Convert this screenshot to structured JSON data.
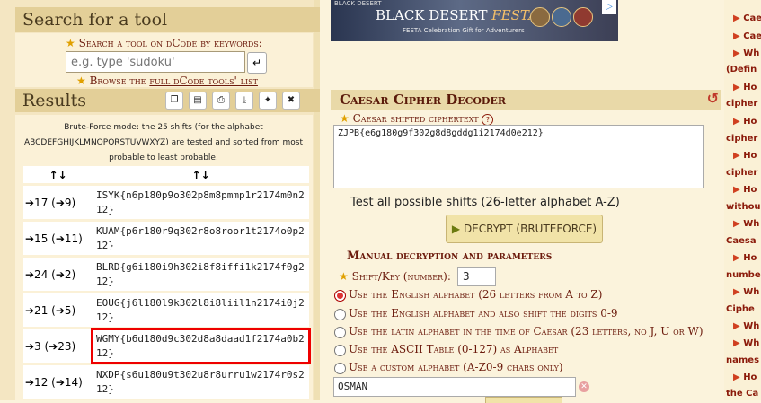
{
  "search": {
    "title": "Search for a tool",
    "label": "Search a tool on dCode by keywords:",
    "placeholder": "e.g. type 'sudoku'",
    "browse_label": "Browse the",
    "browse_link": "full dCode tools' list"
  },
  "results": {
    "title": "Results",
    "description": "Brute-Force mode: the 25 shifts (for the alphabet ABCDEFGHIJKLMNOPQRSTUVWXYZ) are tested and sorted from most probable to least probable.",
    "col1": "↑↓",
    "col2": "↑↓",
    "rows": [
      {
        "shift": "➔17 (➔9)",
        "text": "ISYK{n6p180p9o302p8m8pmmp1r2174m0n212}"
      },
      {
        "shift": "➔15 (➔11)",
        "text": "KUAM{p6r180r9q302r8o8roor1t2174o0p212}"
      },
      {
        "shift": "➔24 (➔2)",
        "text": "BLRD{g6i180i9h302i8f8iffi1k2174f0g212}"
      },
      {
        "shift": "➔21 (➔5)",
        "text": "EOUG{j6l180l9k302l8i8liil1n2174i0j212}"
      },
      {
        "shift": "➔3 (➔23)",
        "text": "WGMY{b6d180d9c302d8a8daad1f2174a0b212}"
      },
      {
        "shift": "➔12 (➔14)",
        "text": "NXDP{s6u180u9t302u8r8urru1w2174r0s212}"
      }
    ]
  },
  "ad": {
    "brand": "BLACK DESERT",
    "festa": "FESTA",
    "tagline": "FESTA Celebration Gift for Adventurers"
  },
  "decoder": {
    "title": "Caesar Cipher Decoder",
    "cipher_label": "Caesar shifted ciphertext",
    "cipher_value": "ZJPB{e6g180g9f302g8d8gddg1i2174d0e212}",
    "test_all": "Test all possible shifts (26-letter alphabet A-Z)",
    "bruteforce_button": "DECRYPT (BRUTEFORCE)",
    "manual_title": "Manual decryption and parameters",
    "shift_label": "Shift/Key (number):",
    "shift_value": "3",
    "options": [
      "Use the English alphabet (26 letters from A to Z)",
      "Use the English alphabet and also shift the digits 0-9",
      "Use the latin alphabet in the time of Caesar (23 letters, no J, U or W)",
      "Use the ASCII Table (0-127) as Alphabet",
      "Use a custom alphabet (A-Z0-9 chars only)"
    ],
    "custom_alphabet": "OSMAN"
  },
  "sidebar": {
    "links": [
      "Cae",
      "Cae",
      "Wh",
      "(Defin",
      "Ho",
      "cipher",
      "Ho",
      "cipher",
      "Ho",
      "cipher",
      "Ho",
      "withou",
      "Wh",
      "Caesa",
      "Ho",
      "numbe",
      "Wh",
      "Ciphe",
      "Wh",
      "Wh",
      "names",
      "Ho",
      "the Ca"
    ]
  },
  "colors": {
    "accent": "#6b1a0c",
    "highlight": "#e00000",
    "panel_head": "#e3cf98"
  }
}
